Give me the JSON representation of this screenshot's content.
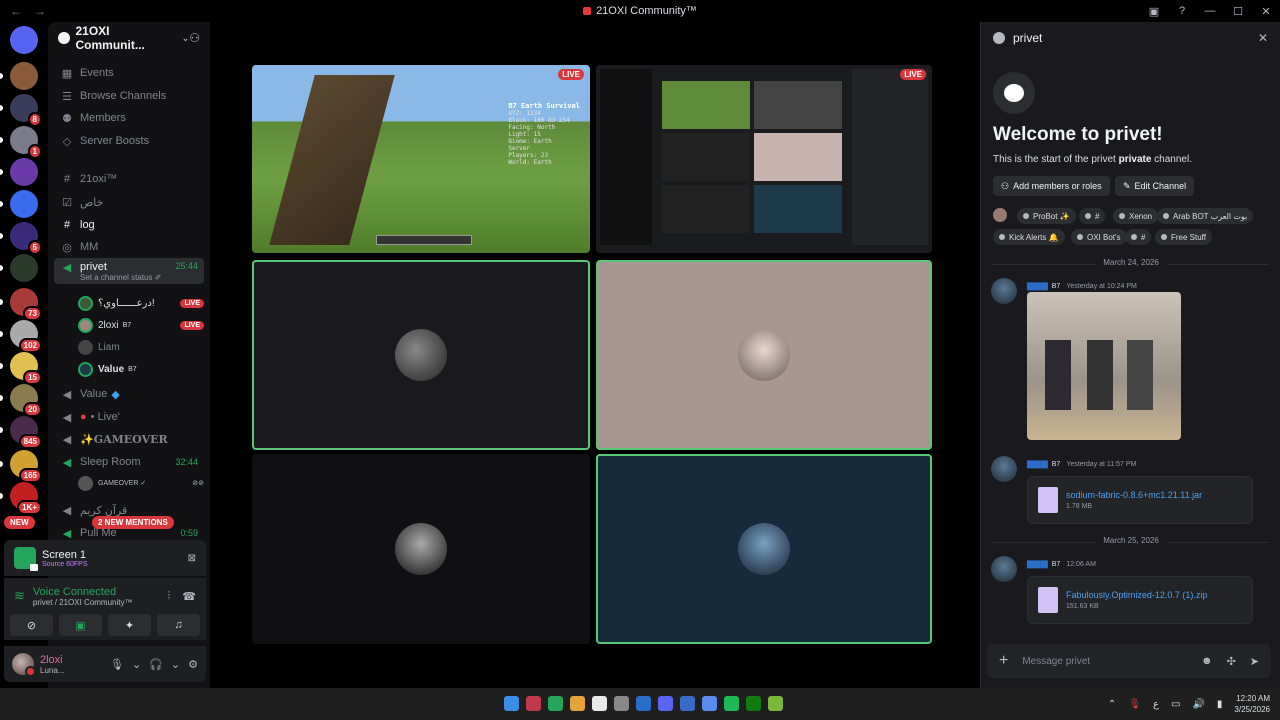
{
  "window": {
    "title": "21OXI Community™",
    "back": "←",
    "forward": "→"
  },
  "servers": [
    {
      "name": "discord-home",
      "color": "#5865f2",
      "count": ""
    },
    {
      "name": "server-2",
      "color": "#8a5a3a",
      "count": ""
    },
    {
      "name": "server-3",
      "color": "#3a3a5a",
      "count": "8"
    },
    {
      "name": "server-4",
      "color": "#7a7a8a",
      "count": "1"
    },
    {
      "name": "server-5",
      "color": "#6a3aa8",
      "count": ""
    },
    {
      "name": "server-6",
      "color": "#3a6af0",
      "count": ""
    },
    {
      "name": "server-7",
      "color": "#3a2a7a",
      "count": "5"
    },
    {
      "name": "server-8",
      "color": "#2a3a2a",
      "count": ""
    },
    {
      "name": "server-9",
      "color": "#a83a3a",
      "count": "73"
    },
    {
      "name": "server-10",
      "color": "#aaaaaa",
      "count": "102"
    },
    {
      "name": "server-11",
      "color": "#e0c050",
      "count": "15"
    },
    {
      "name": "server-12",
      "color": "#8a7a50",
      "count": "20"
    },
    {
      "name": "server-13",
      "color": "#4a2a4a",
      "count": "845"
    },
    {
      "name": "server-14",
      "color": "#d0a030",
      "count": "165"
    },
    {
      "name": "server-15",
      "color": "#c02020",
      "count": "1K+"
    }
  ],
  "new_badge": "NEW",
  "guild": {
    "name": "21OXI Communit...",
    "menu": [
      "Events",
      "Browse Channels",
      "Members",
      "Server Boosts"
    ],
    "channels": {
      "c1": "21oxi™",
      "c2": "خاص",
      "c3": "log",
      "c4": "MM",
      "privet": "privet",
      "privet_timer": "25:44",
      "privet_status": "Set a channel status ✐",
      "value": "Value",
      "live": "• Live'",
      "gameover": "✨GAMEOVER",
      "sleep": "Sleep Room",
      "sleep_timer": "32:44",
      "quran": "قرآن كريم",
      "pull": "Pull Me",
      "pull_timer": "0:59"
    },
    "members": [
      {
        "name": "درعــــــاوي؟!",
        "tag": "",
        "live": "LIVE"
      },
      {
        "name": "2loxi",
        "tag": "B7",
        "live": "LIVE"
      },
      {
        "name": "Liam",
        "tag": "",
        "live": ""
      },
      {
        "name": "Value",
        "tag": "B7",
        "live": ""
      }
    ],
    "sleep_member": "GAMEOVER ✓",
    "mentions": "2 NEW MENTIONS"
  },
  "screen_panel": {
    "name": "Screen 1",
    "source": "Source 60FPS"
  },
  "voice_panel": {
    "status": "Voice Connected",
    "location": "privet / 21OXI Community™"
  },
  "user_panel": {
    "name": "2loxi",
    "status": "Luna..."
  },
  "stage": {
    "live_label": "LIVE",
    "mc_title": "B7 Earth Survival",
    "mc_lines": [
      "XYZ: 1234",
      "Block: 160 63 254",
      "Facing: North",
      "Light: 15",
      "Biome: Earth",
      "Server",
      "Players: 23",
      "World: Earth"
    ]
  },
  "right_panel": {
    "channel": "privet",
    "welcome_title": "Welcome to privet!",
    "welcome_pre": "This is the start of the privet ",
    "welcome_bold": "private",
    "welcome_post": " channel.",
    "add_members": "Add members or roles",
    "edit_channel": "Edit Channel",
    "chips": [
      "ProBot ✨",
      "#",
      "Xenon",
      "Arab BOT بوت العرب",
      "Kick Alerts 🔔",
      "OXI Bot's",
      "#",
      "Free Stuff"
    ],
    "date1": "March 24, 2026",
    "date2": "March 25, 2026",
    "messages": [
      {
        "tag": "B7",
        "time": "Yesterday at 10:24 PM"
      },
      {
        "tag": "B7",
        "time": "Yesterday at 11:57 PM",
        "file": "sodium-fabric-0.8.6+mc1.21.11.jar",
        "size": "1.78 MB"
      },
      {
        "tag": "B7",
        "time": "12:06 AM",
        "file": "Fabulously.Optimized-12.0.7 (1).zip",
        "size": "151.63 KB"
      }
    ],
    "composer_placeholder": "Message privet"
  },
  "taskbar": {
    "time": "12:20 AM",
    "date": "3/25/2026",
    "lang": "ع"
  },
  "colors": {
    "accent": "#5865f2",
    "live": "#da373c",
    "voice": "#23a55a"
  }
}
